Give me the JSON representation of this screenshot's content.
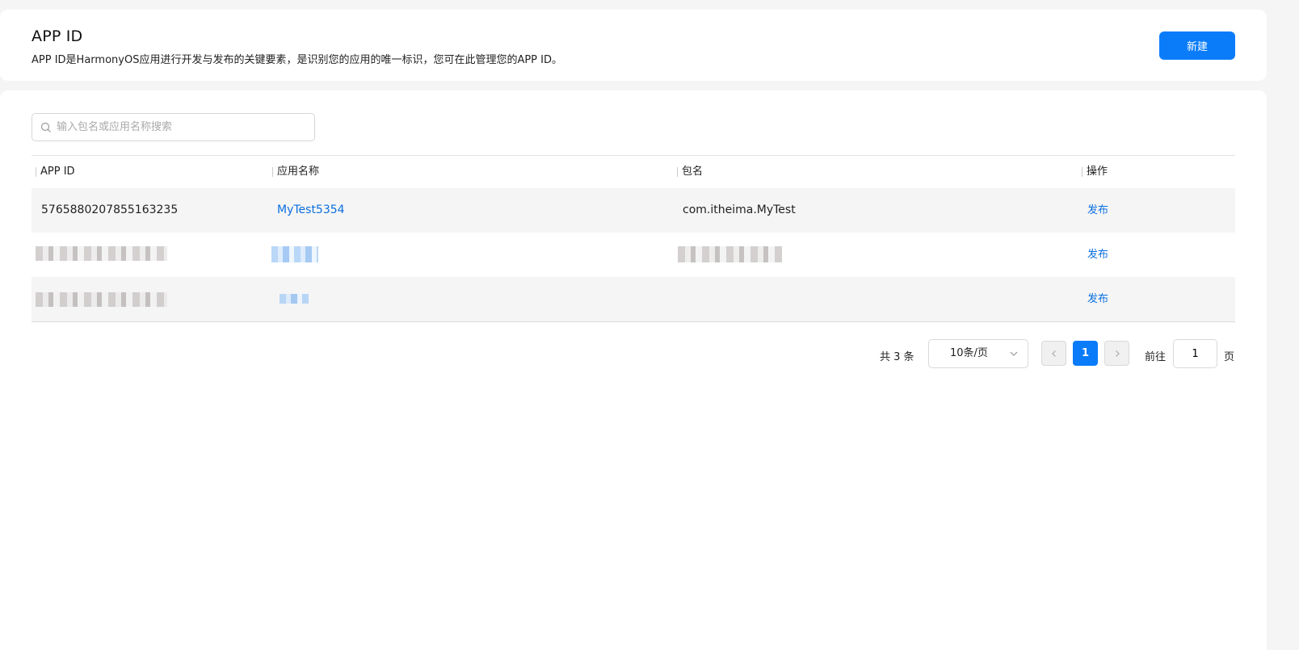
{
  "header": {
    "title": "APP ID",
    "description": "APP ID是HarmonyOS应用进行开发与发布的关键要素，是识别您的应用的唯一标识，您可在此管理您的APP ID。",
    "create_label": "新建"
  },
  "search": {
    "placeholder": "输入包名或应用名称搜索",
    "value": ""
  },
  "table": {
    "columns": [
      "APP ID",
      "应用名称",
      "包名",
      "操作"
    ],
    "rows": [
      {
        "app_id": "5765880207855163235",
        "app_name": "MyTest5354",
        "package": "com.itheima.MyTest",
        "action": "发布",
        "obscured": false
      },
      {
        "app_id": "",
        "app_name": "",
        "package": "",
        "action": "发布",
        "obscured": true
      },
      {
        "app_id": "",
        "app_name": "",
        "package": "",
        "action": "发布",
        "obscured": true
      }
    ]
  },
  "pagination": {
    "total_label": "共 3 条",
    "page_size_label": "10条/页",
    "current_page": "1",
    "prev_icon": "chevron-left-icon",
    "next_icon": "chevron-right-icon",
    "goto_label": "前往",
    "goto_value": "1",
    "page_suffix": "页"
  },
  "colors": {
    "accent": "#0a7cfa",
    "link": "#0a6fe0",
    "background": "#f5f5f5"
  }
}
